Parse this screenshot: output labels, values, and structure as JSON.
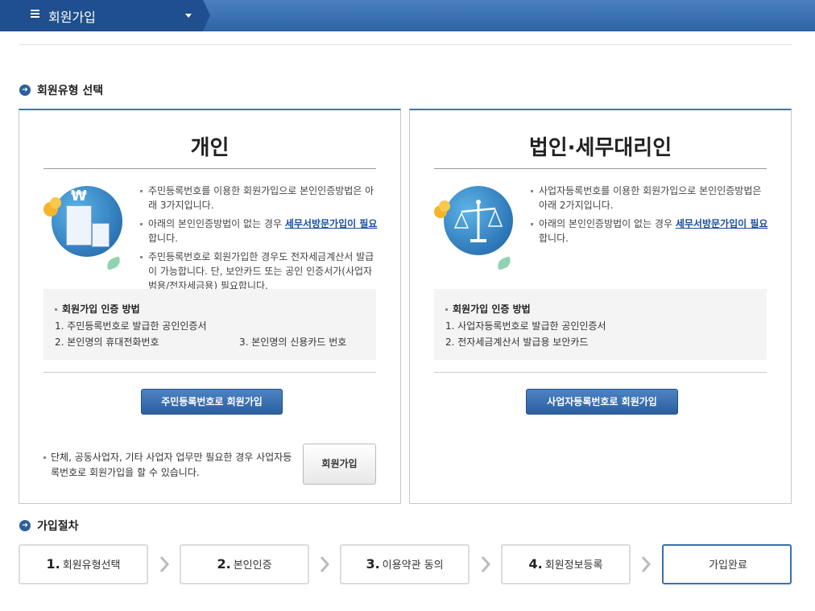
{
  "header": {
    "menu_icon": "hamburger-icon",
    "title": "회원가입",
    "dropdown_icon": "caret-down-icon"
  },
  "section_type": {
    "title": "회원유형 선택",
    "bullet_glyph": "➜"
  },
  "individual": {
    "title": "개인",
    "desc": [
      {
        "pre": "주민등록번호를 이용한 회원가입으로 본인인증방법은 아래 3가지입니다.",
        "link": "",
        "post": ""
      },
      {
        "pre": "아래의 본인인증방법이 없는 경우 ",
        "link": "세무서방문가입이 필요",
        "post": "합니다."
      },
      {
        "pre": "주민등록번호로 회원가입한 경우도 전자세금계산서 발급이 가능합니다. 단, 보안카드 또는 공인 인증서가(사업자범용/전자세금용) 필요합니다.",
        "link": "",
        "post": ""
      }
    ],
    "methods_title": "회원가입 인증 방법",
    "methods": [
      "1. 주민등록번호로 발급한 공인인증서",
      "2. 본인명의 휴대전화번호",
      "3. 본인명의 신용카드 번호"
    ],
    "button": "주민등록번호로 회원가입",
    "note": "단체, 공동사업자, 기타 사업자 업무만 필요한 경우 사업자등록번호로 회원가입을 할 수 있습니다.",
    "note_button": "회원가입",
    "won_symbol": "₩"
  },
  "corporate": {
    "title": "법인·세무대리인",
    "desc": [
      {
        "pre": "사업자등록번호를 이용한 회원가입으로 본인인증방법은 아래 2가지입니다.",
        "link": "",
        "post": ""
      },
      {
        "pre": "아래의 본인인증방법이 없는 경우 ",
        "link": "세무서방문가입이 필요",
        "post": "합니다."
      }
    ],
    "methods_title": "회원가입 인증 방법",
    "methods": [
      "1. 사업자등록번호로 발급한 공인인증서",
      "2. 전자세금계산서 발급용 보안카드"
    ],
    "button": "사업자등록번호로 회원가입"
  },
  "section_steps": {
    "title": "가입절차"
  },
  "steps": [
    {
      "num": "1.",
      "label": "회원유형선택"
    },
    {
      "num": "2.",
      "label": "본인인증"
    },
    {
      "num": "3.",
      "label": "이용약관 동의"
    },
    {
      "num": "4.",
      "label": "회원정보등록"
    },
    {
      "num": "",
      "label": "가입완료"
    }
  ],
  "colors": {
    "header_blue": "#2e64a6",
    "button_blue": "#2b5f9f",
    "link": "#1a4ea0",
    "active_step_border": "#3a6fae"
  }
}
